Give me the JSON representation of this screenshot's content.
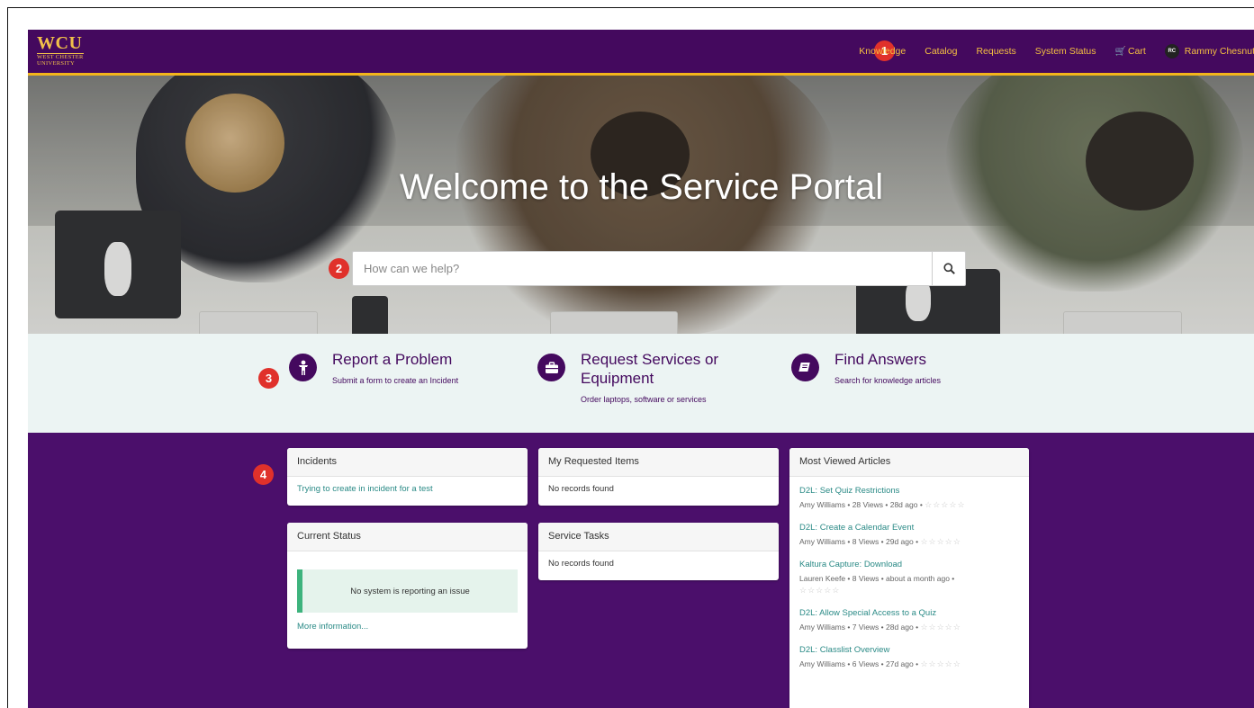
{
  "header": {
    "logo_big": "WCU",
    "logo_line1": "WEST CHESTER",
    "logo_line2": "UNIVERSITY",
    "nav": [
      "Knowledge",
      "Catalog",
      "Requests",
      "System Status"
    ],
    "cart_label": "Cart",
    "user_initials": "RC",
    "user_name": "Rammy Chesnut"
  },
  "callouts": [
    "1",
    "2",
    "3",
    "4"
  ],
  "hero": {
    "title": "Welcome to the Service Portal",
    "search_placeholder": "How can we help?"
  },
  "actions": [
    {
      "title": "Report a Problem",
      "subtitle": "Submit a form to create an Incident",
      "icon": "person-icon"
    },
    {
      "title_line1": "Request Services or",
      "title_line2": "Equipment",
      "subtitle": "Order laptops, software or services",
      "icon": "briefcase-icon"
    },
    {
      "title": "Find Answers",
      "subtitle": "Search for knowledge articles",
      "icon": "book-icon"
    }
  ],
  "widgets": {
    "incidents": {
      "title": "Incidents",
      "item": "Trying to create in incident for a test"
    },
    "current_status": {
      "title": "Current Status",
      "message": "No system is reporting an issue",
      "more": "More information..."
    },
    "requested_items": {
      "title": "My Requested Items",
      "empty": "No records found"
    },
    "service_tasks": {
      "title": "Service Tasks",
      "empty": "No records found"
    },
    "most_viewed": {
      "title": "Most Viewed Articles",
      "articles": [
        {
          "title": "D2L: Set Quiz Restrictions",
          "meta": "Amy Williams  •  28 Views  •  28d ago  •"
        },
        {
          "title": "D2L: Create a Calendar Event",
          "meta": "Amy Williams  •  8 Views  •  29d ago  •"
        },
        {
          "title": "Kaltura Capture: Download",
          "meta": "Lauren Keefe  •  8 Views  •  about a month ago  •"
        },
        {
          "title": "D2L: Allow Special Access to a Quiz",
          "meta": "Amy Williams  •  7 Views  •  28d ago  •"
        },
        {
          "title": "D2L: Classlist Overview",
          "meta": "Amy Williams  •  6 Views  •  27d ago  •"
        }
      ],
      "stars": "☆☆☆☆☆"
    }
  },
  "colors": {
    "brand_purple": "#44095e",
    "brand_gold": "#f3b51b",
    "link_teal": "#2a8a86",
    "status_green": "#3db37d",
    "badge_red": "#e0312b"
  }
}
